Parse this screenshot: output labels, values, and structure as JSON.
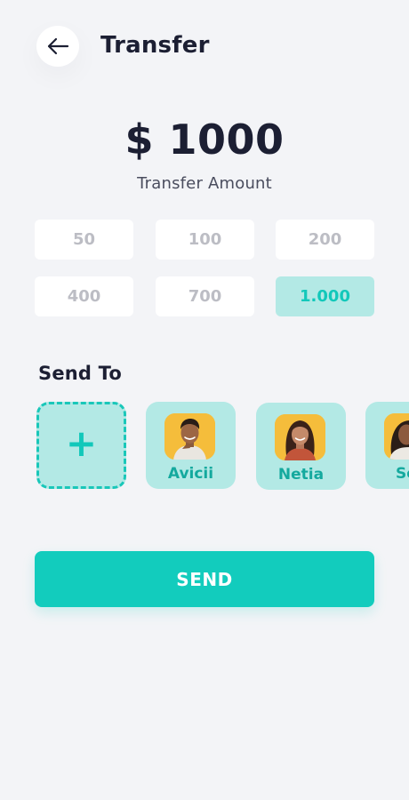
{
  "header": {
    "title": "Transfer",
    "back_icon": "arrow-left-icon"
  },
  "amount": {
    "value": "$ 1000",
    "label": "Transfer Amount"
  },
  "presets": [
    {
      "label": "50",
      "selected": false
    },
    {
      "label": "100",
      "selected": false
    },
    {
      "label": "200",
      "selected": false
    },
    {
      "label": "400",
      "selected": false
    },
    {
      "label": "700",
      "selected": false
    },
    {
      "label": "1.000",
      "selected": true
    }
  ],
  "send_to": {
    "title": "Send To",
    "add_icon": "plus-icon",
    "add_glyph": "+",
    "contacts": [
      {
        "name": "Avicii"
      },
      {
        "name": "Netia"
      },
      {
        "name": "Seg"
      }
    ]
  },
  "send_button": {
    "label": "SEND"
  },
  "colors": {
    "background": "#f3f4f7",
    "accent": "#12ccbd",
    "accent_light": "#b3e9e5",
    "text_dark": "#1c1f33",
    "text_muted": "#bcbdc4",
    "avatar_bg": "#f5bd3b"
  }
}
